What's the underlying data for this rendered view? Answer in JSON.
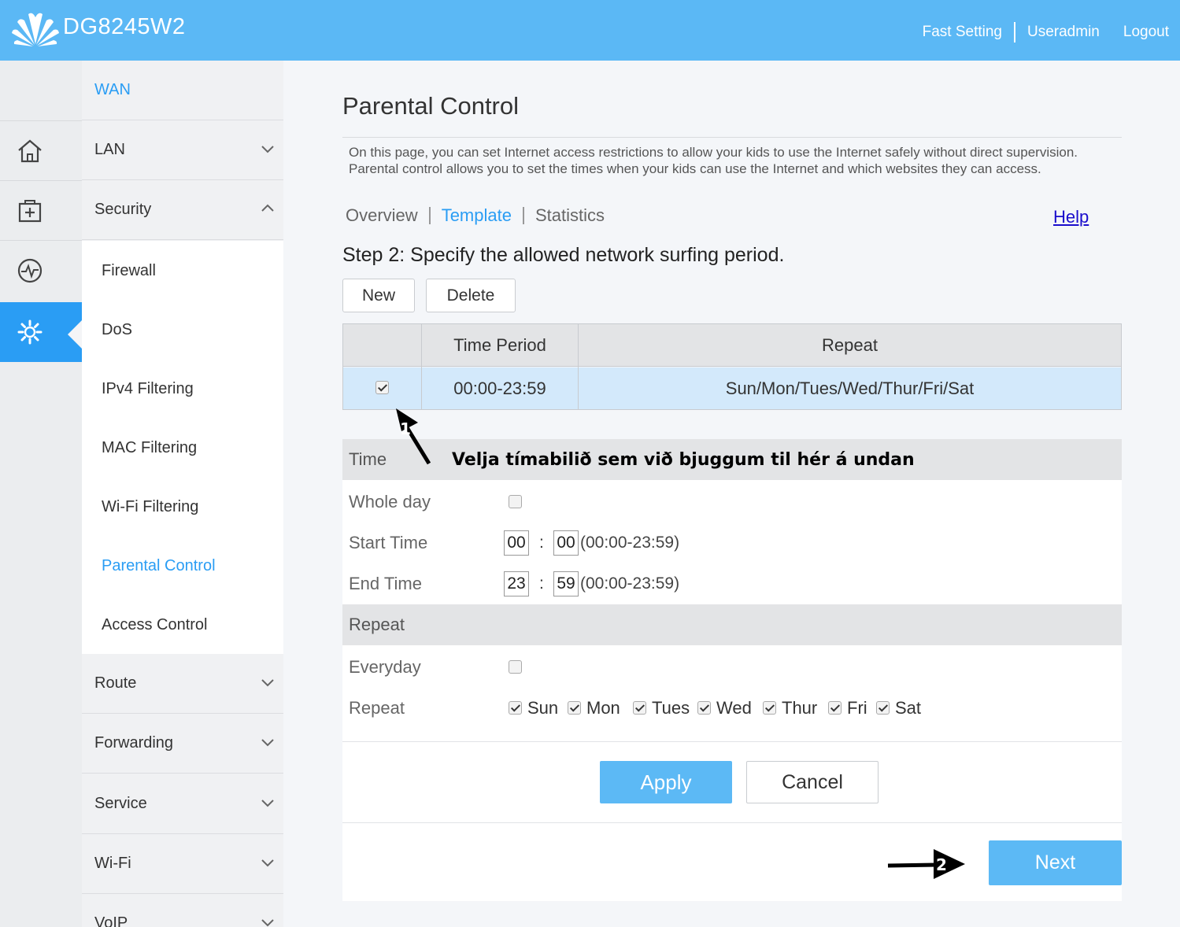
{
  "header": {
    "model": "DG8245W2",
    "links": [
      "Fast Setting",
      "Useradmin",
      "Logout"
    ]
  },
  "menu": {
    "items": [
      {
        "label": "WAN"
      },
      {
        "label": "LAN"
      },
      {
        "label": "Security"
      },
      {
        "label": "Route"
      },
      {
        "label": "Forwarding"
      },
      {
        "label": "Service"
      },
      {
        "label": "Wi-Fi"
      },
      {
        "label": "VoIP"
      }
    ],
    "security_sub": [
      "Firewall",
      "DoS",
      "IPv4 Filtering",
      "MAC Filtering",
      "Wi-Fi Filtering",
      "Parental Control",
      "Access Control"
    ]
  },
  "page": {
    "title": "Parental Control",
    "description_1": "On this page, you can set Internet access restrictions to allow your kids to use the Internet safely without direct supervision.",
    "description_2": "Parental control allows you to set the times when your kids can use the Internet and which websites they can access.",
    "tabs": [
      "Overview",
      "Template",
      "Statistics"
    ],
    "help": "Help",
    "step": "Step 2: Specify the allowed network surfing period.",
    "new_button": "New",
    "delete_button": "Delete"
  },
  "table": {
    "headers": [
      "Time Period",
      "Repeat"
    ],
    "rows": [
      {
        "time_period": "00:00-23:59",
        "repeat": "Sun/Mon/Tues/Wed/Thur/Fri/Sat"
      }
    ]
  },
  "form": {
    "time_section": "Time",
    "whole_day_label": "Whole day",
    "start_label": "Start Time",
    "end_label": "End Time",
    "start_hour": "00",
    "start_min": "00",
    "end_hour": "23",
    "end_min": "59",
    "colon": ":",
    "range_hint": "(00:00-23:59)",
    "repeat_section": "Repeat",
    "everyday_label": "Everyday",
    "repeat_label": "Repeat",
    "days": [
      "Sun",
      "Mon",
      "Tues",
      "Wed",
      "Thur",
      "Fri",
      "Sat"
    ]
  },
  "actions": {
    "apply": "Apply",
    "cancel": "Cancel",
    "next": "Next"
  },
  "annotation": {
    "text": "Velja tímabilið sem við bjuggum til hér á undan",
    "marker_1": "1",
    "marker_2": "2"
  },
  "colors": {
    "header_bg": "#5bb8f5",
    "accent": "#2a9df4",
    "row_selected": "#d3e9fb"
  }
}
